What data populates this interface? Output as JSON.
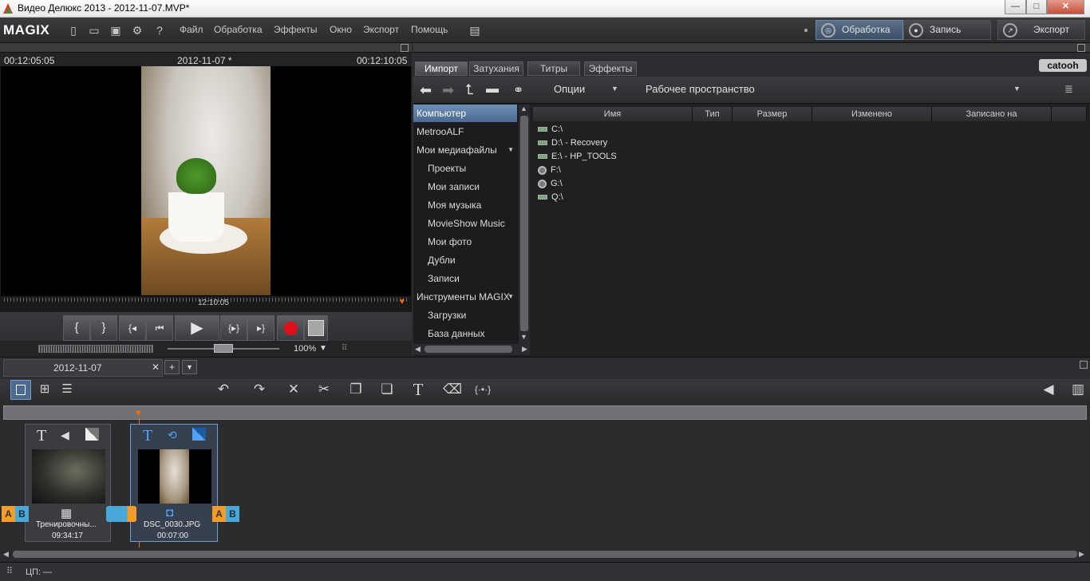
{
  "window": {
    "title": "Видео Делюкс 2013 - 2012-11-07.MVP*",
    "min": "—",
    "max": "□",
    "close": "✕"
  },
  "app": {
    "logo": "MAGIX"
  },
  "menu": [
    "Файл",
    "Обработка",
    "Эффекты",
    "Окно",
    "Экспорт",
    "Помощь"
  ],
  "modes": {
    "edit": "Обработка",
    "record": "Запись",
    "export": "Экспорт"
  },
  "monitor": {
    "tc_left": "00:12:05:05",
    "title": "2012-11-07 *",
    "tc_right": "00:12:10:05",
    "scrub_tc": "12:10:05",
    "zoom": "100%"
  },
  "media_tabs": [
    "Импорт",
    "Затухания",
    "Титры",
    "Эффекты"
  ],
  "media_logo": "catooh",
  "media_toolbar": {
    "options": "Опции",
    "workspace": "Рабочее пространство"
  },
  "nav": [
    {
      "label": "Компьютер",
      "sel": true
    },
    {
      "label": "MetrooALF"
    },
    {
      "label": "Мои медиафайлы",
      "arrow": true
    },
    {
      "label": "Проекты",
      "sub": true
    },
    {
      "label": "Мои записи",
      "sub": true
    },
    {
      "label": "Моя музыка",
      "sub": true
    },
    {
      "label": "MovieShow Music",
      "sub": true
    },
    {
      "label": "Мои фото",
      "sub": true
    },
    {
      "label": "Дубли",
      "sub": true
    },
    {
      "label": "Записи",
      "sub": true
    },
    {
      "label": "Инструменты MAGIX",
      "arrow": true
    },
    {
      "label": "Загрузки",
      "sub": true
    },
    {
      "label": "База данных",
      "sub": true
    }
  ],
  "columns": [
    "Имя",
    "Тип",
    "Размер",
    "Изменено",
    "Записано на"
  ],
  "drives": [
    {
      "label": "C:\\",
      "kind": "hdd"
    },
    {
      "label": "D:\\ - Recovery",
      "kind": "hdd"
    },
    {
      "label": "E:\\ - HP_TOOLS",
      "kind": "hdd"
    },
    {
      "label": "F:\\",
      "kind": "cd"
    },
    {
      "label": "G:\\",
      "kind": "cd"
    },
    {
      "label": "Q:\\",
      "kind": "hdd"
    }
  ],
  "project_tab": "2012-11-07",
  "clips": [
    {
      "name": "Тренировочны...",
      "duration": "09:34:17"
    },
    {
      "name": "DSC_0030.JPG",
      "duration": "00:07:00"
    }
  ],
  "status": {
    "label": "ЦП:",
    "value": "—"
  }
}
